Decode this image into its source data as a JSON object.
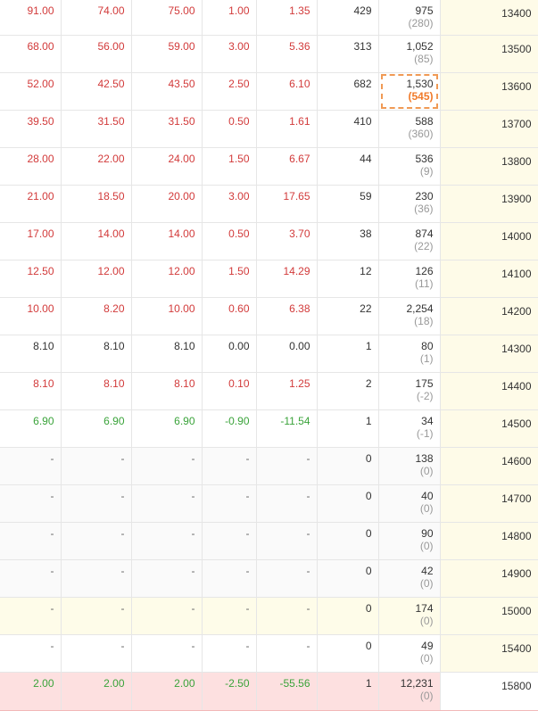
{
  "rows": [
    {
      "c1": "91.00",
      "c2": "74.00",
      "c3": "75.00",
      "c4": "1.00",
      "c5": "1.35",
      "vol": "429",
      "oi": "975",
      "oi_chg": "(280)",
      "strike": "13400",
      "trend": "up",
      "bg": "white"
    },
    {
      "c1": "68.00",
      "c2": "56.00",
      "c3": "59.00",
      "c4": "3.00",
      "c5": "5.36",
      "vol": "313",
      "oi": "1,052",
      "oi_chg": "(85)",
      "strike": "13500",
      "trend": "up",
      "bg": "white"
    },
    {
      "c1": "52.00",
      "c2": "42.50",
      "c3": "43.50",
      "c4": "2.50",
      "c5": "6.10",
      "vol": "682",
      "oi": "1,530",
      "oi_chg": "(545)",
      "strike": "13600",
      "trend": "up",
      "bg": "white",
      "highlight": true
    },
    {
      "c1": "39.50",
      "c2": "31.50",
      "c3": "31.50",
      "c4": "0.50",
      "c5": "1.61",
      "vol": "410",
      "oi": "588",
      "oi_chg": "(360)",
      "strike": "13700",
      "trend": "up",
      "bg": "white"
    },
    {
      "c1": "28.00",
      "c2": "22.00",
      "c3": "24.00",
      "c4": "1.50",
      "c5": "6.67",
      "vol": "44",
      "oi": "536",
      "oi_chg": "(9)",
      "strike": "13800",
      "trend": "up",
      "bg": "white"
    },
    {
      "c1": "21.00",
      "c2": "18.50",
      "c3": "20.00",
      "c4": "3.00",
      "c5": "17.65",
      "vol": "59",
      "oi": "230",
      "oi_chg": "(36)",
      "strike": "13900",
      "trend": "up",
      "bg": "white"
    },
    {
      "c1": "17.00",
      "c2": "14.00",
      "c3": "14.00",
      "c4": "0.50",
      "c5": "3.70",
      "vol": "38",
      "oi": "874",
      "oi_chg": "(22)",
      "strike": "14000",
      "trend": "up",
      "bg": "white"
    },
    {
      "c1": "12.50",
      "c2": "12.00",
      "c3": "12.00",
      "c4": "1.50",
      "c5": "14.29",
      "vol": "12",
      "oi": "126",
      "oi_chg": "(11)",
      "strike": "14100",
      "trend": "up",
      "bg": "white"
    },
    {
      "c1": "10.00",
      "c2": "8.20",
      "c3": "10.00",
      "c4": "0.60",
      "c5": "6.38",
      "vol": "22",
      "oi": "2,254",
      "oi_chg": "(18)",
      "strike": "14200",
      "trend": "up",
      "bg": "white"
    },
    {
      "c1": "8.10",
      "c2": "8.10",
      "c3": "8.10",
      "c4": "0.00",
      "c5": "0.00",
      "vol": "1",
      "oi": "80",
      "oi_chg": "(1)",
      "strike": "14300",
      "trend": "flat",
      "bg": "white"
    },
    {
      "c1": "8.10",
      "c2": "8.10",
      "c3": "8.10",
      "c4": "0.10",
      "c5": "1.25",
      "vol": "2",
      "oi": "175",
      "oi_chg": "(-2)",
      "strike": "14400",
      "trend": "up",
      "bg": "white"
    },
    {
      "c1": "6.90",
      "c2": "6.90",
      "c3": "6.90",
      "c4": "-0.90",
      "c5": "-11.54",
      "vol": "1",
      "oi": "34",
      "oi_chg": "(-1)",
      "strike": "14500",
      "trend": "down",
      "bg": "white"
    },
    {
      "c1": "-",
      "c2": "-",
      "c3": "-",
      "c4": "-",
      "c5": "-",
      "vol": "0",
      "oi": "138",
      "oi_chg": "(0)",
      "strike": "14600",
      "trend": "dash",
      "bg": "gray"
    },
    {
      "c1": "-",
      "c2": "-",
      "c3": "-",
      "c4": "-",
      "c5": "-",
      "vol": "0",
      "oi": "40",
      "oi_chg": "(0)",
      "strike": "14700",
      "trend": "dash",
      "bg": "gray"
    },
    {
      "c1": "-",
      "c2": "-",
      "c3": "-",
      "c4": "-",
      "c5": "-",
      "vol": "0",
      "oi": "90",
      "oi_chg": "(0)",
      "strike": "14800",
      "trend": "dash",
      "bg": "gray"
    },
    {
      "c1": "-",
      "c2": "-",
      "c3": "-",
      "c4": "-",
      "c5": "-",
      "vol": "0",
      "oi": "42",
      "oi_chg": "(0)",
      "strike": "14900",
      "trend": "dash",
      "bg": "gray"
    },
    {
      "c1": "-",
      "c2": "-",
      "c3": "-",
      "c4": "-",
      "c5": "-",
      "vol": "0",
      "oi": "174",
      "oi_chg": "(0)",
      "strike": "15000",
      "trend": "dash",
      "bg": "yellow"
    },
    {
      "c1": "-",
      "c2": "-",
      "c3": "-",
      "c4": "-",
      "c5": "-",
      "vol": "0",
      "oi": "49",
      "oi_chg": "(0)",
      "strike": "15400",
      "trend": "dash",
      "bg": "white"
    },
    {
      "c1": "2.00",
      "c2": "2.00",
      "c3": "2.00",
      "c4": "-2.50",
      "c5": "-55.56",
      "vol": "1",
      "oi": "12,231",
      "oi_chg": "(0)",
      "strike": "15800",
      "trend": "down",
      "bg": "pink"
    }
  ],
  "colors": {
    "up": "#d23a3a",
    "down": "#3aa33a",
    "flat": "#333333",
    "highlight_border": "#f09a55",
    "highlight_text": "#f07a2a"
  }
}
